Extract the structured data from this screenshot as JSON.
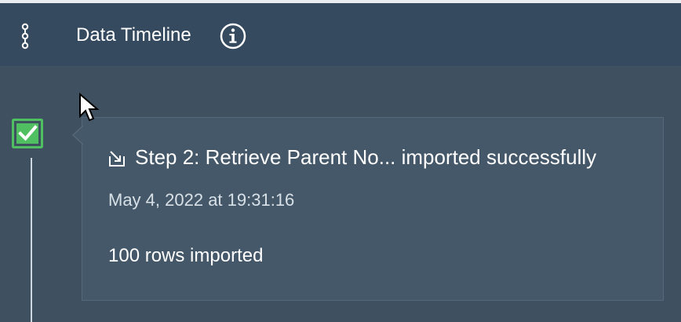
{
  "header": {
    "title": "Data Timeline",
    "menu_icon": "vertical-nodes-icon",
    "info_icon": "info-circle-icon"
  },
  "timeline": {
    "event": {
      "status_icon": "checkmark-checkbox-icon",
      "import_icon": "import-arrow-icon",
      "title": "Step 2: Retrieve Parent No... imported successfully",
      "timestamp": "May 4, 2022 at 19:31:16",
      "detail": "100 rows imported"
    }
  },
  "colors": {
    "header_background": "#354a5e",
    "content_background": "#3f5161",
    "card_background": "#455869",
    "success_green": "#4fbf62",
    "text_primary": "#ffffff",
    "text_secondary": "#d8e0e7"
  }
}
